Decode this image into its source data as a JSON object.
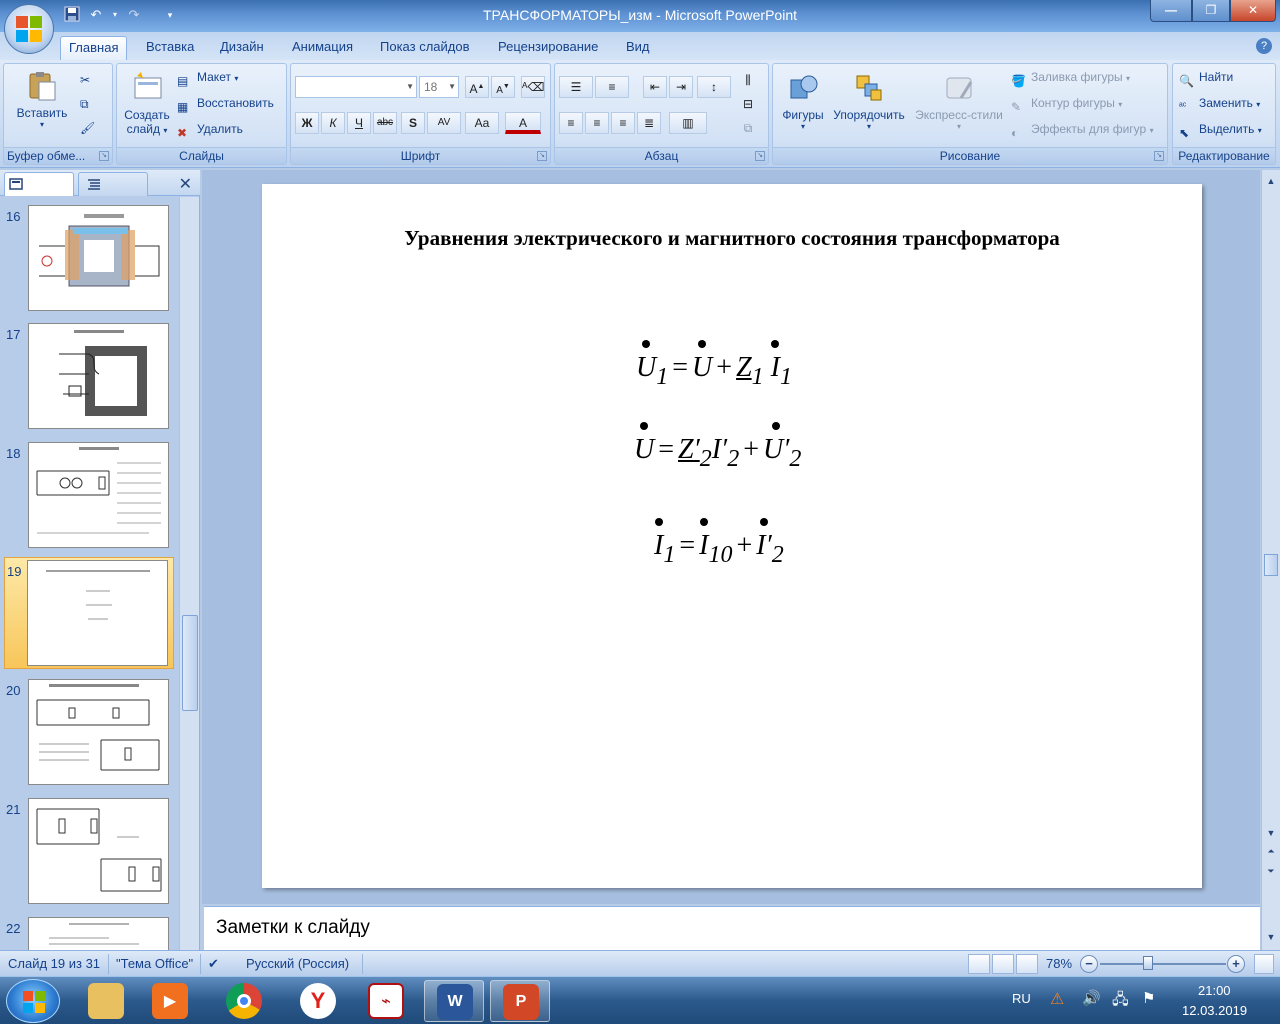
{
  "window": {
    "title": "ТРАНСФОРМАТОРЫ_изм - Microsoft PowerPoint"
  },
  "ribbon": {
    "tabs": [
      "Главная",
      "Вставка",
      "Дизайн",
      "Анимация",
      "Показ слайдов",
      "Рецензирование",
      "Вид"
    ],
    "active_tab": "Главная",
    "clipboard": {
      "label": "Буфер обме...",
      "paste": "Вставить"
    },
    "slides": {
      "label": "Слайды",
      "new_slide_line1": "Создать",
      "new_slide_line2": "слайд",
      "layout": "Макет",
      "reset": "Восстановить",
      "delete": "Удалить"
    },
    "font": {
      "label": "Шрифт",
      "size": "18",
      "bold": "Ж",
      "italic": "К",
      "underline": "Ч",
      "strike": "abc",
      "shadow": "S",
      "spacing": "AV",
      "case": "Aa",
      "color": "A",
      "grow": "A",
      "shrink": "A"
    },
    "paragraph": {
      "label": "Абзац"
    },
    "drawing": {
      "label": "Рисование",
      "shapes": "Фигуры",
      "arrange": "Упорядочить",
      "quick_styles": "Экспресс-стили",
      "fill": "Заливка фигуры",
      "outline": "Контур фигуры",
      "effects": "Эффекты для фигур"
    },
    "editing": {
      "label": "Редактирование",
      "find": "Найти",
      "replace": "Заменить",
      "select": "Выделить"
    }
  },
  "thumbnails": {
    "numbers": [
      "16",
      "17",
      "18",
      "19",
      "20",
      "21",
      "22"
    ],
    "selected": "19"
  },
  "slide": {
    "title": "Уравнения электрического и магнитного состояния трансформатора",
    "eq1": {
      "a": "U",
      "a_sub": "1",
      "eq": "=",
      "b": "U",
      "plus": "+",
      "c": "Z",
      "c_sub": "1",
      "d": "I",
      "d_sub": "1"
    },
    "eq2": {
      "a": "U",
      "eq": "=",
      "b": "Z′",
      "b_sub": "2",
      "c": "I′",
      "c_sub": "2",
      "plus": "+",
      "d": "U′",
      "d_sub": "2"
    },
    "eq3": {
      "a": "I",
      "a_sub": "1",
      "eq": "=",
      "b": "I",
      "b_sub": "10",
      "plus": "+",
      "c": "I′",
      "c_sub": "2"
    }
  },
  "notes": {
    "placeholder": "Заметки к слайду"
  },
  "status": {
    "slide_counter": "Слайд 19 из 31",
    "theme": "\"Тема Office\"",
    "language": "Русский (Россия)",
    "zoom": "78%"
  },
  "taskbar": {
    "lang": "RU",
    "time": "21:00",
    "date": "12.03.2019"
  },
  "colors": {
    "ribbon_text": "#15428b",
    "selected_thumb": "#f8c65a",
    "accent_orange": "#e3a33e"
  }
}
